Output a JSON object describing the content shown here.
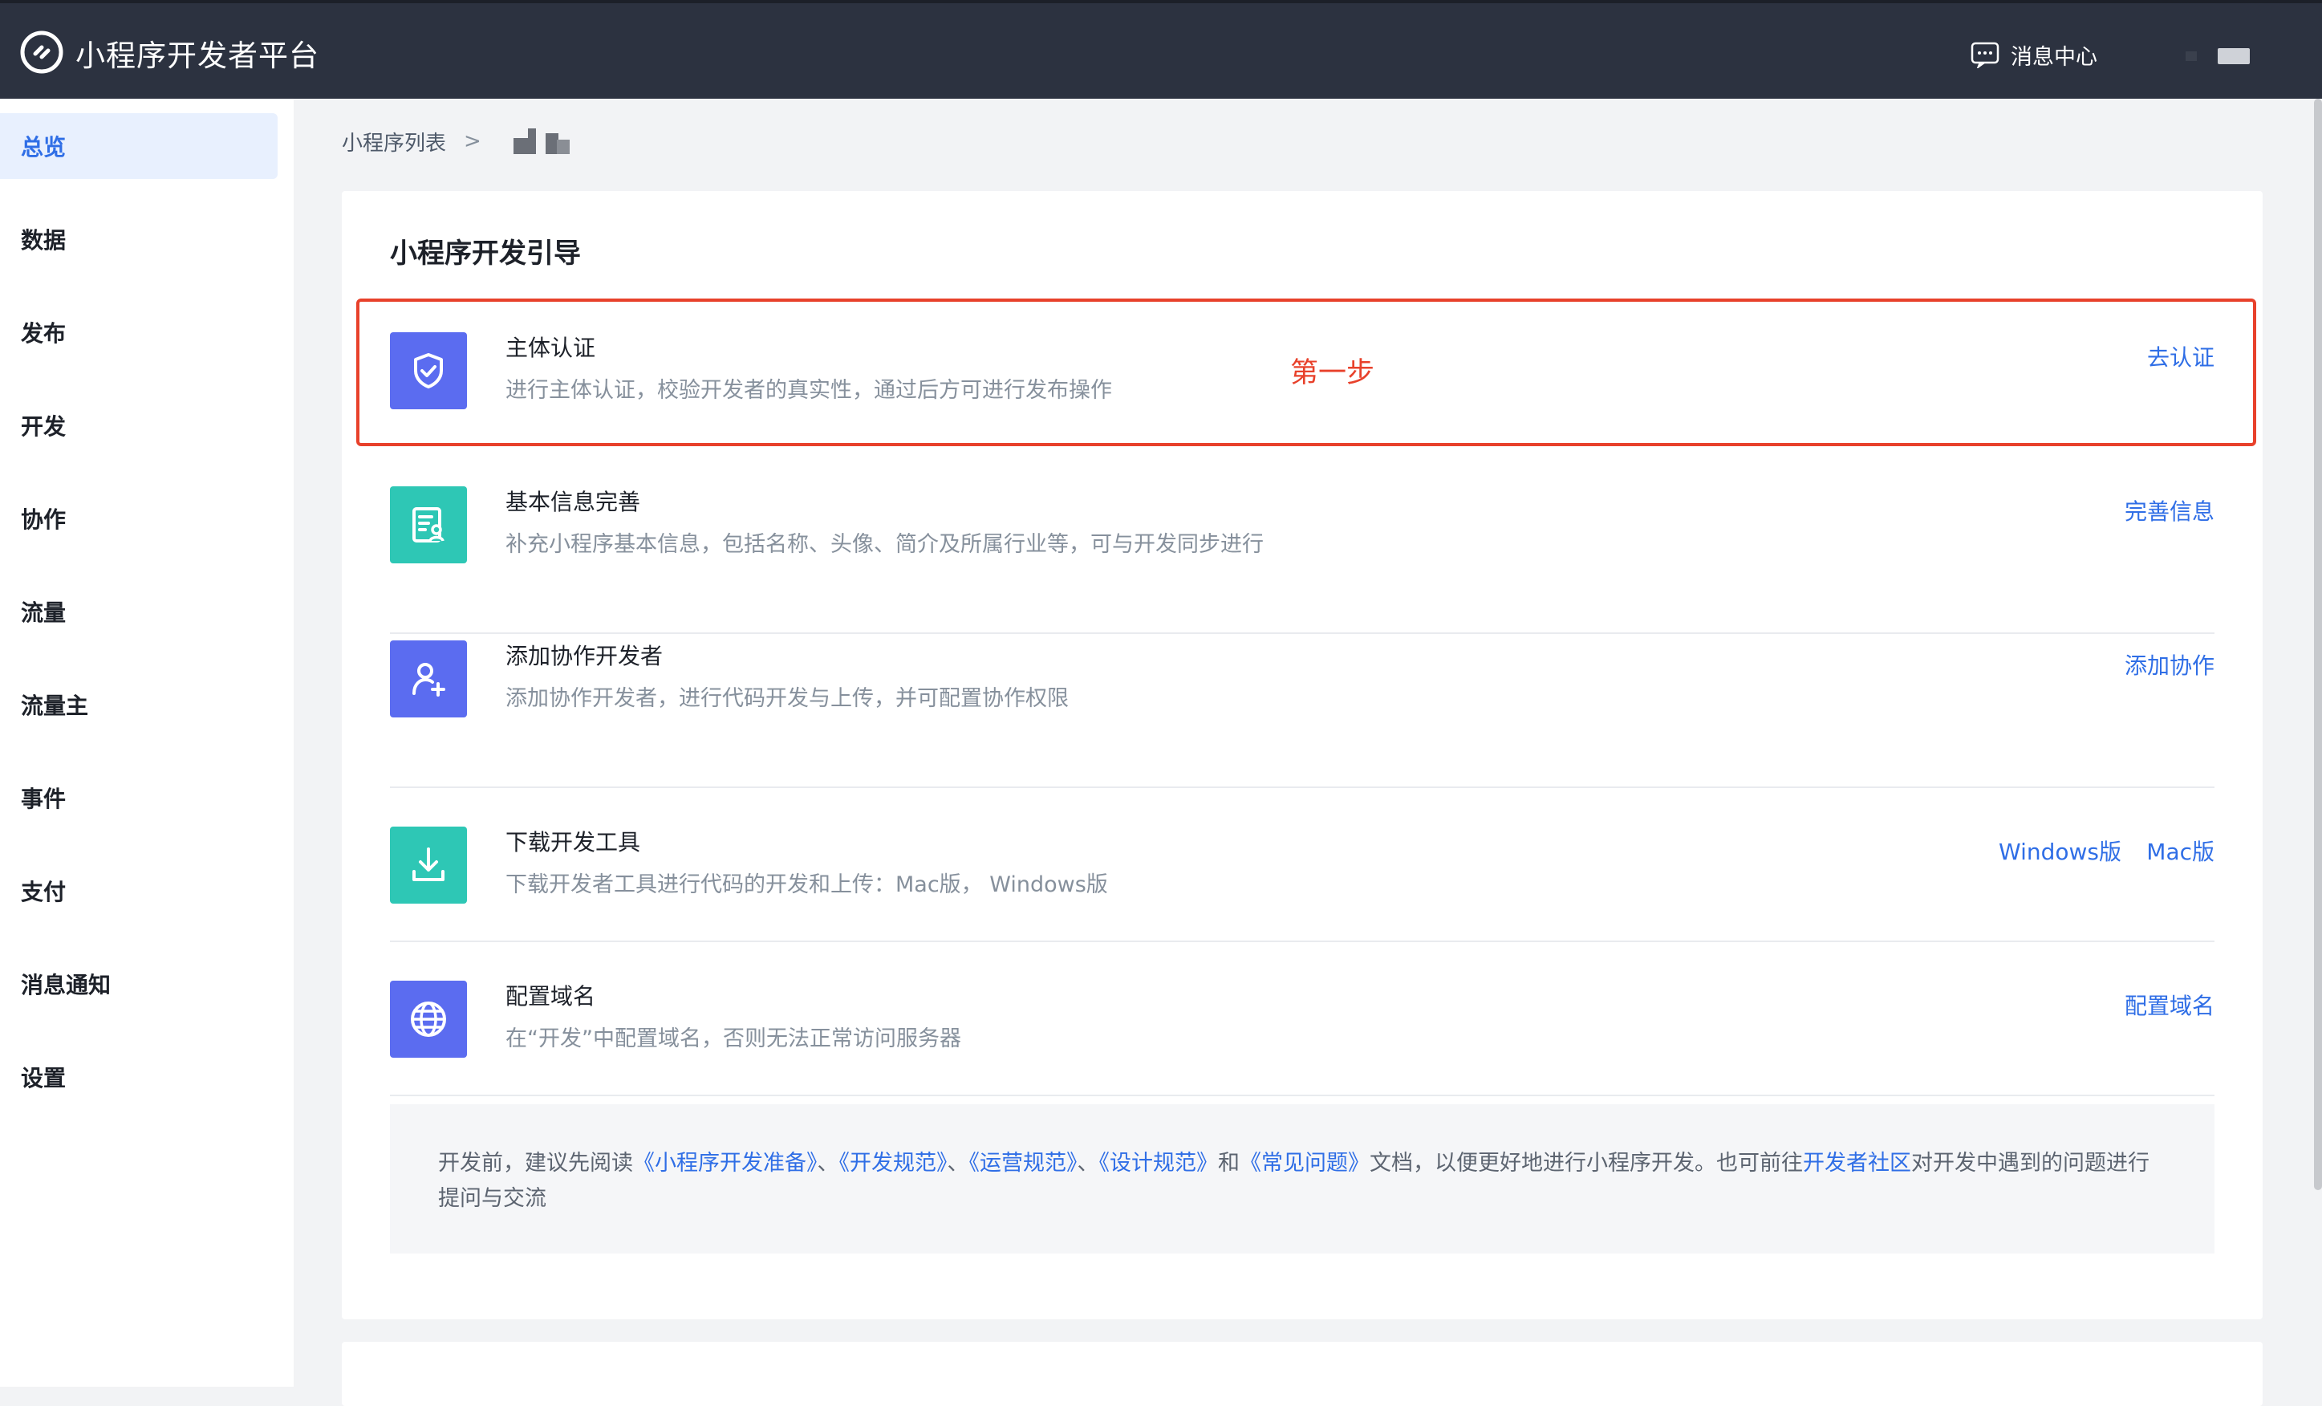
{
  "header": {
    "app_title": "小程序开发者平台",
    "message_center": "消息中心",
    "icons": {
      "logo": "miniprogram-logo-icon",
      "message": "message-icon"
    }
  },
  "sidebar": {
    "items": [
      {
        "label": "总览",
        "active": true
      },
      {
        "label": "数据"
      },
      {
        "label": "发布"
      },
      {
        "label": "开发"
      },
      {
        "label": "协作"
      },
      {
        "label": "流量"
      },
      {
        "label": "流量主"
      },
      {
        "label": "事件"
      },
      {
        "label": "支付"
      },
      {
        "label": "消息通知"
      },
      {
        "label": "设置"
      }
    ]
  },
  "breadcrumb": {
    "root": "小程序列表",
    "separator": ">"
  },
  "guide": {
    "title": "小程序开发引导",
    "annotation": "第一步",
    "steps": [
      {
        "title": "主体认证",
        "desc": "进行主体认证，校验开发者的真实性，通过后方可进行发布操作",
        "action": "去认证",
        "icon": "shield-check-icon",
        "color": "#5b6cf0"
      },
      {
        "title": "基本信息完善",
        "desc": "补充小程序基本信息，包括名称、头像、简介及所属行业等，可与开发同步进行",
        "action": "完善信息",
        "icon": "profile-card-icon",
        "color": "#2ec7b5"
      },
      {
        "title": "添加协作开发者",
        "desc": "添加协作开发者，进行代码开发与上传，并可配置协作权限",
        "action": "添加协作",
        "icon": "add-user-icon",
        "color": "#5b6cf0"
      },
      {
        "title": "下载开发工具",
        "desc": "下载开发者工具进行代码的开发和上传：Mac版， Windows版",
        "action_windows": "Windows版",
        "action_mac": "Mac版",
        "icon": "download-icon",
        "color": "#2ec7b5"
      },
      {
        "title": "配置域名",
        "desc": "在“开发”中配置域名，否则无法正常访问服务器",
        "action": "配置域名",
        "icon": "globe-icon",
        "color": "#5b6cf0"
      }
    ]
  },
  "notice": {
    "prefix": "开发前，建议先阅读",
    "link1": "《小程序开发准备》",
    "sep1": "、",
    "link2": "《开发规范》",
    "sep2": "、",
    "link3": "《运营规范》",
    "sep3": "、",
    "link4": "《设计规范》",
    "and": "和",
    "link5": "《常见问题》",
    "middle": "文档，以便更好地进行小程序开发。也可前往",
    "link6": "开发者社区",
    "suffix": "对开发中遇到的问题进行提问与交流"
  },
  "colors": {
    "topbar": "#2c3240",
    "accent": "#2f6ee6",
    "highlight": "#e8412b"
  }
}
